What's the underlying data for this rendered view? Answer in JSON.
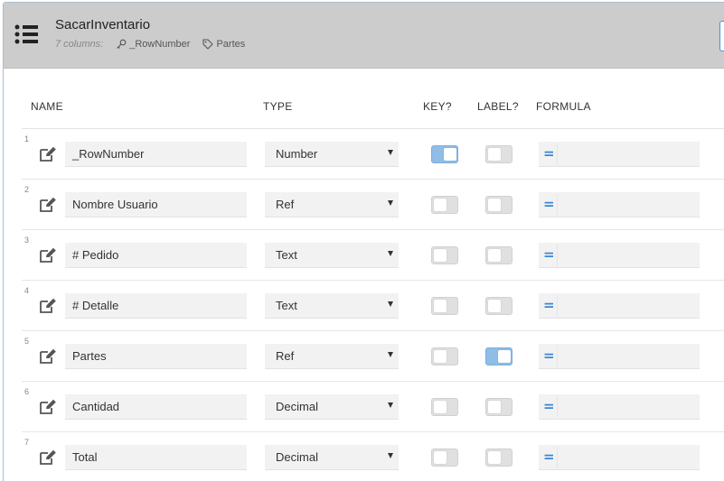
{
  "header": {
    "title": "SacarInventario",
    "column_count": "7 columns:",
    "key_column": "_RowNumber",
    "label_column": "Partes"
  },
  "columns_header": {
    "name": "NAME",
    "type": "TYPE",
    "key": "KEY?",
    "label": "LABEL?",
    "formula": "FORMULA"
  },
  "rows": [
    {
      "num": "1",
      "name": "_RowNumber",
      "type": "Number",
      "key": true,
      "label": false,
      "formula_symbol": "="
    },
    {
      "num": "2",
      "name": "Nombre Usuario",
      "type": "Ref",
      "key": false,
      "label": false,
      "formula_symbol": "="
    },
    {
      "num": "3",
      "name": "# Pedido",
      "type": "Text",
      "key": false,
      "label": false,
      "formula_symbol": "="
    },
    {
      "num": "4",
      "name": "# Detalle",
      "type": "Text",
      "key": false,
      "label": false,
      "formula_symbol": "="
    },
    {
      "num": "5",
      "name": "Partes",
      "type": "Ref",
      "key": false,
      "label": true,
      "formula_symbol": "="
    },
    {
      "num": "6",
      "name": "Cantidad",
      "type": "Decimal",
      "key": false,
      "label": false,
      "formula_symbol": "="
    },
    {
      "num": "7",
      "name": "Total",
      "type": "Decimal",
      "key": false,
      "label": false,
      "formula_symbol": "="
    }
  ],
  "icons": {
    "menu": "list-menu-icon",
    "key": "key-icon",
    "label": "tag-icon",
    "edit": "edit-icon",
    "dropdown": "dropdown-arrow-icon"
  },
  "colors": {
    "header_bg": "#cccccc",
    "toggle_on": "#90bde6",
    "toggle_off": "#e0e0e0",
    "formula_accent": "#3a86d6",
    "field_bg": "#f2f2f2"
  }
}
